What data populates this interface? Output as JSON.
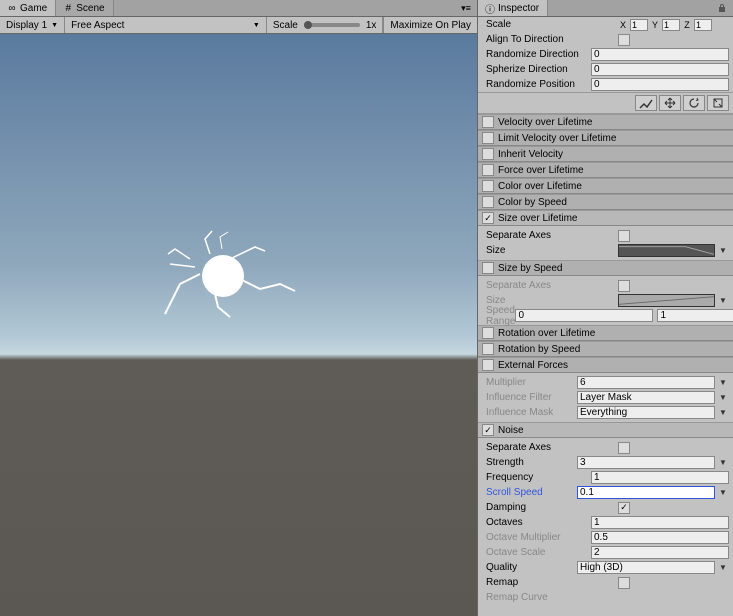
{
  "tabs": {
    "game": "Game",
    "scene": "Scene",
    "inspector": "Inspector"
  },
  "toolbar": {
    "display": "Display 1",
    "aspect": "Free Aspect",
    "scale_label": "Scale",
    "scale_value": "1x",
    "maximize": "Maximize On Play"
  },
  "top_props": {
    "scale_label": "Scale",
    "x": "X",
    "y": "Y",
    "z": "Z",
    "xv": "1",
    "yv": "1",
    "zv": "1",
    "align_label": "Align To Direction",
    "rand_dir_label": "Randomize Direction",
    "rand_dir_value": "0",
    "spherize_label": "Spherize Direction",
    "spherize_value": "0",
    "rand_pos_label": "Randomize Position",
    "rand_pos_value": "0"
  },
  "modules": {
    "velocity": "Velocity over Lifetime",
    "limit_velocity": "Limit Velocity over Lifetime",
    "inherit_velocity": "Inherit Velocity",
    "force": "Force over Lifetime",
    "color_lifetime": "Color over Lifetime",
    "color_speed": "Color by Speed",
    "size_lifetime": "Size over Lifetime",
    "size_speed": "Size by Speed",
    "rotation_lifetime": "Rotation over Lifetime",
    "rotation_speed": "Rotation by Speed",
    "external_forces": "External Forces",
    "noise": "Noise"
  },
  "size_lifetime": {
    "separate_axes": "Separate Axes",
    "size": "Size"
  },
  "size_speed": {
    "separate_axes": "Separate Axes",
    "size": "Size",
    "speed_range": "Speed Range",
    "range_min": "0",
    "range_max": "1"
  },
  "external_forces": {
    "multiplier": "Multiplier",
    "multiplier_value": "6",
    "influence_filter": "Influence Filter",
    "influence_filter_value": "Layer Mask",
    "influence_mask": "Influence Mask",
    "influence_mask_value": "Everything"
  },
  "noise": {
    "separate_axes": "Separate Axes",
    "strength": "Strength",
    "strength_value": "3",
    "frequency": "Frequency",
    "frequency_value": "1",
    "scroll_speed": "Scroll Speed",
    "scroll_speed_value": "0.1",
    "damping": "Damping",
    "octaves": "Octaves",
    "octaves_value": "1",
    "octave_multiplier": "Octave Multiplier",
    "octave_multiplier_value": "0.5",
    "octave_scale": "Octave Scale",
    "octave_scale_value": "2",
    "quality": "Quality",
    "quality_value": "High (3D)",
    "remap": "Remap",
    "remap_curve": "Remap Curve"
  }
}
